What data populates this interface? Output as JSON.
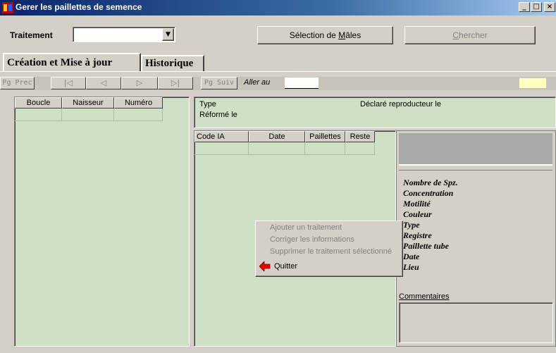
{
  "window": {
    "title": "Gerer les paillettes de semence",
    "min": "_",
    "max": "□",
    "close": "×"
  },
  "toolbar": {
    "traitement_label": "Traitement",
    "traitement_value": "",
    "selection_pre": "Sélection de ",
    "selection_accel": "M",
    "selection_post": "âles",
    "chercher_accel": "C",
    "chercher_post": "hercher"
  },
  "tabs": [
    "Création et Mise à jour",
    "Historique"
  ],
  "nav": {
    "prev_page": "Pg Prec",
    "first": "|◁",
    "prev": "◁",
    "next": "▷",
    "last": "▷|",
    "next_page": "Pg Suiv",
    "goto_label": "Aller au",
    "goto_value": ""
  },
  "left_grid": {
    "columns": [
      "Boucle",
      "Naisseur",
      "Numéro"
    ]
  },
  "info": {
    "type_label": "Type",
    "declared_label": "Déclaré reproducteur le",
    "reformed_label": "Réformé le"
  },
  "ia_grid": {
    "columns": [
      "Code IA",
      "Date",
      "Paillettes",
      "Reste"
    ]
  },
  "details": {
    "fields": [
      "Nombre de Spz.",
      "Concentration",
      "Motilité",
      "Couleur",
      "Type",
      "Registre",
      "Paillette tube",
      "Date",
      "Lieu"
    ],
    "comments_label": "Commentaires"
  },
  "context_menu": {
    "items": [
      {
        "label": "Ajouter un traitement",
        "enabled": false
      },
      {
        "label": "Corriger les informations",
        "enabled": false
      },
      {
        "label": "Supprimer le traitement sélectionné",
        "enabled": false
      },
      {
        "label": "Quitter",
        "enabled": true,
        "icon": "red-arrow-icon"
      }
    ]
  },
  "colors": {
    "panel_green": "#cfe0c5",
    "titlebar": "#0a246a",
    "yellow_indicator": "#ffffc0"
  }
}
